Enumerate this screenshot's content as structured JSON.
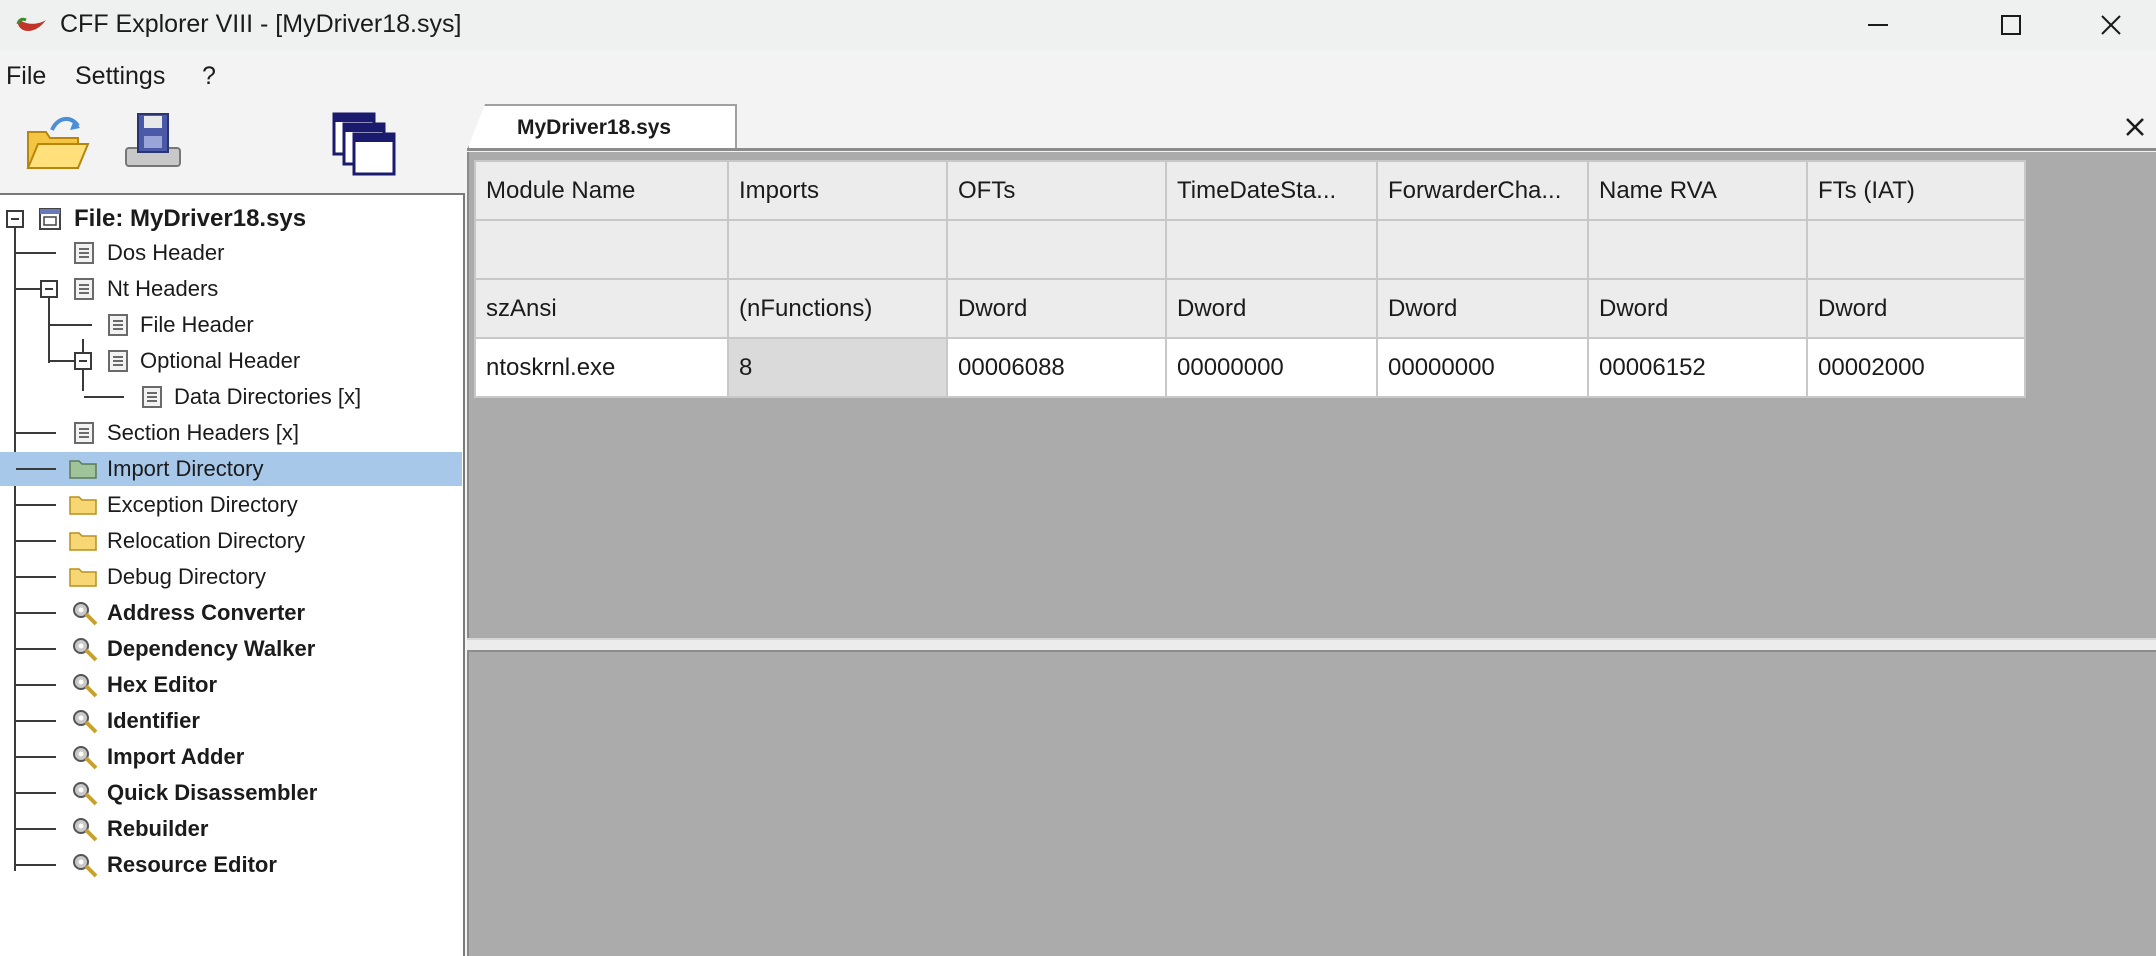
{
  "window": {
    "title": "CFF Explorer VIII - [MyDriver18.sys]",
    "app_icon": "chili-pepper-icon",
    "controls": [
      "minimize-icon",
      "maximize-icon",
      "close-icon"
    ]
  },
  "menu": {
    "file": "File",
    "settings": "Settings",
    "help": "?"
  },
  "toolbar": {
    "buttons": [
      "open-folder-icon",
      "save-disk-icon",
      "windows-icon"
    ]
  },
  "tree": {
    "root": "File: MyDriver18.sys",
    "items": [
      {
        "label": "Dos Header",
        "icon": "document-icon"
      },
      {
        "label": "Nt Headers",
        "icon": "document-icon"
      },
      {
        "label": "File Header",
        "icon": "document-icon"
      },
      {
        "label": "Optional Header",
        "icon": "document-icon"
      },
      {
        "label": "Data Directories [x]",
        "icon": "document-icon"
      },
      {
        "label": "Section Headers [x]",
        "icon": "document-icon"
      },
      {
        "label": "Import Directory",
        "icon": "folder-icon",
        "selected": true
      },
      {
        "label": "Exception Directory",
        "icon": "folder-icon"
      },
      {
        "label": "Relocation Directory",
        "icon": "folder-icon"
      },
      {
        "label": "Debug Directory",
        "icon": "folder-icon"
      },
      {
        "label": "Address Converter",
        "icon": "tool-icon"
      },
      {
        "label": "Dependency Walker",
        "icon": "tool-icon"
      },
      {
        "label": "Hex Editor",
        "icon": "tool-icon"
      },
      {
        "label": "Identifier",
        "icon": "tool-icon"
      },
      {
        "label": "Import Adder",
        "icon": "tool-icon"
      },
      {
        "label": "Quick Disassembler",
        "icon": "tool-icon"
      },
      {
        "label": "Rebuilder",
        "icon": "tool-icon"
      },
      {
        "label": "Resource Editor",
        "icon": "tool-icon"
      }
    ]
  },
  "tab": {
    "label": "MyDriver18.sys",
    "close": "×"
  },
  "import_table": {
    "headers": [
      "Module Name",
      "Imports",
      "OFTs",
      "TimeDateSta...",
      "ForwarderCha...",
      "Name RVA",
      "FTs (IAT)"
    ],
    "subheaders": [
      "",
      "",
      "",
      "",
      "",
      "",
      ""
    ],
    "types": [
      "szAnsi",
      "(nFunctions)",
      "Dword",
      "Dword",
      "Dword",
      "Dword",
      "Dword"
    ],
    "rows": [
      [
        "ntoskrnl.exe",
        "8",
        "00006088",
        "00000000",
        "00000000",
        "00006152",
        "00002000"
      ]
    ]
  },
  "colors": {
    "selection": "#a8c8ea",
    "pane_background": "#ababab",
    "header_cell": "#ececec"
  }
}
